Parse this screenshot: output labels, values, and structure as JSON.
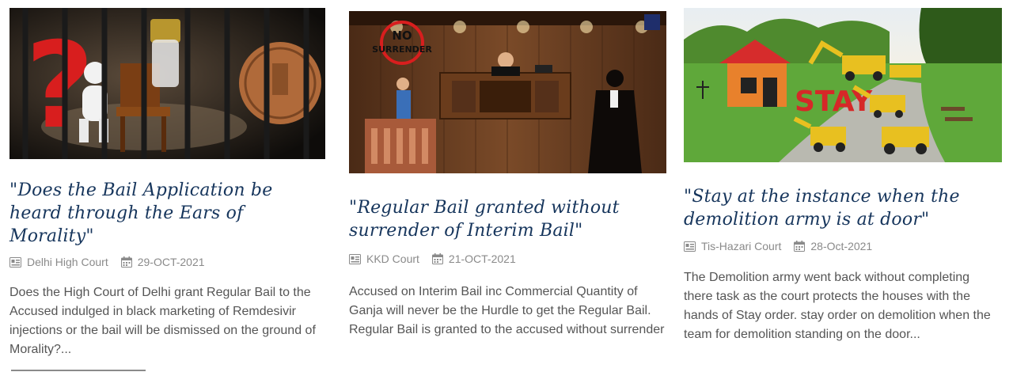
{
  "cards": [
    {
      "title": "\"Does the Bail Application be heard through the Ears of Morality\"",
      "court": "Delhi High Court",
      "date": "29-OCT-2021",
      "excerpt": "Does the High Court of Delhi grant Regular Bail to the Accused indulged in black marketing of Remdesivir injections or the bail will be dismissed on the ground of Morality?...",
      "image_icon": "question-mark-jail-illustration"
    },
    {
      "title": "\"Regular Bail granted without surrender of Interim Bail\"",
      "court": "KKD Court",
      "date": "21-OCT-2021",
      "excerpt": "Accused on Interim Bail inc Commercial Quantity of Ganja will never be the Hurdle to get the Regular Bail. Regular Bail is granted to the accused without surrender",
      "image_text": {
        "line1": "NO",
        "line2": "SURRENDER"
      },
      "image_icon": "courtroom-illustration"
    },
    {
      "title": "\"Stay at the instance when the demolition army is at door\"",
      "court": "Tis-Hazari Court",
      "date": "28-Oct-2021",
      "excerpt": "The Demolition army went back without completing there task as the court protects the houses with the hands of Stay order. stay order on demolition when the team for demolition standing on the door...",
      "image_text": {
        "stamp": "STAY"
      },
      "image_icon": "bulldozer-house-illustration"
    }
  ],
  "colors": {
    "title": "#16355c",
    "meta": "#8a8a8a",
    "text": "#555555",
    "stay": "#d62828"
  },
  "icons": {
    "court": "gavel-card-icon",
    "date": "calendar-icon"
  }
}
